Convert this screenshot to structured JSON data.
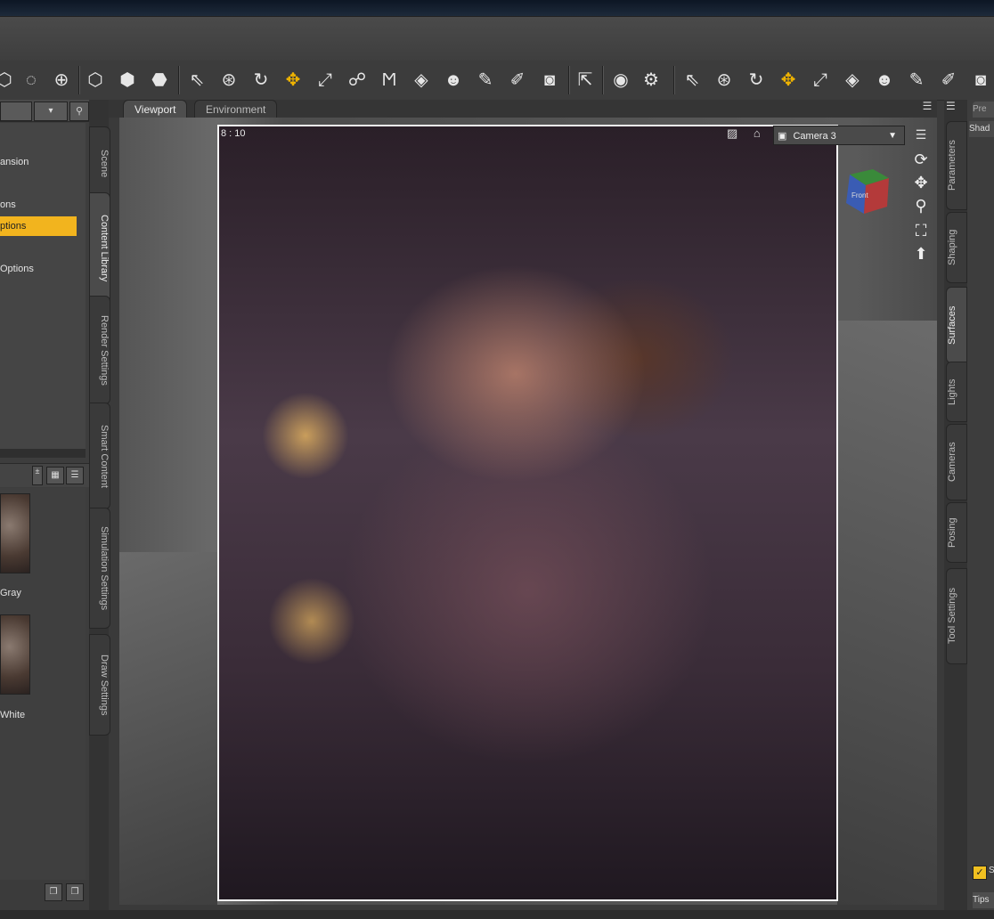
{
  "left_panel": {
    "dropdown_arrow": "▾",
    "tree_items": [
      {
        "label": "ansion",
        "selected": false
      },
      {
        "label": "ons",
        "selected": false
      },
      {
        "label": "ptions",
        "selected": true
      },
      {
        "label": "Options",
        "selected": false
      }
    ],
    "thumbnails": [
      {
        "label": "Gray"
      },
      {
        "label": "White"
      }
    ]
  },
  "left_tabs": [
    "Scene",
    "Content Library",
    "Render Settings",
    "Smart Content",
    "Simulation Settings",
    "Draw Settings"
  ],
  "viewport": {
    "tabs": [
      "Viewport",
      "Environment"
    ],
    "active_tab": "Viewport",
    "aspect_ratio": "8 : 10",
    "camera": "Camera 3"
  },
  "right_tabs": [
    "Parameters",
    "Shaping",
    "Surfaces",
    "Lights",
    "Cameras",
    "Posing",
    "Tool Settings"
  ],
  "right_panel": {
    "tab1": "Pre",
    "tab2": "Shad",
    "check_label": "S",
    "tips": "Tips"
  },
  "colors": {
    "selection": "#f2b41e",
    "active_tool": "#f0b400"
  }
}
